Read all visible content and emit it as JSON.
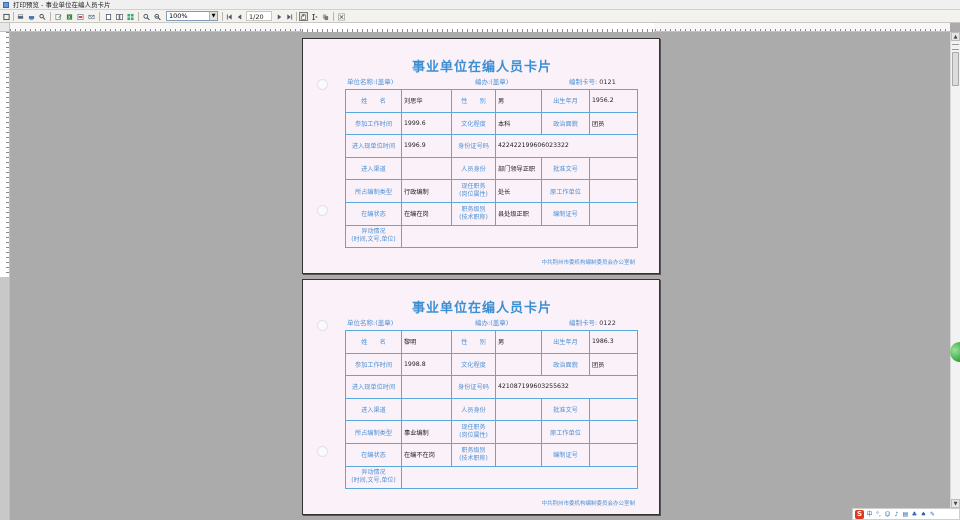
{
  "window": {
    "title": "打印预览 - 事业单位在编人员卡片"
  },
  "toolbar": {
    "zoom": "100%",
    "page": "1/20"
  },
  "labels": {
    "card_title": "事业单位在编人员卡片",
    "unit_name": "单位名称:(盖章)",
    "org_name": "编办:(盖章)",
    "card_no": "编制卡号:",
    "name": "姓　　名",
    "gender": "性　　别",
    "birth": "出生年月",
    "work_start": "参加工作时间",
    "education": "文化程度",
    "politics": "政治面貌",
    "join_unit": "进入现单位时间",
    "id_no": "身份证号码",
    "channel": "进入渠道",
    "identity": "人员身份",
    "approval_no": "批准文号",
    "staff_type": "所占编制类型",
    "position_l1": "现任职务",
    "position_l2": "(岗位属性)",
    "former_unit": "原工作单位",
    "status": "在编状态",
    "grade_l1": "职务级别",
    "grade_l2": "(技术职称)",
    "cert_no": "编制证号",
    "change_l1": "异动情况",
    "change_l2": "(时间,文号,单位)",
    "footer": "中共荆州市委机构编制委员会办公室制"
  },
  "cards": [
    {
      "card_no": "0121",
      "name": "刘思华",
      "gender": "男",
      "birth": "1956.2",
      "work_start": "1999.6",
      "education": "本科",
      "politics": "团员",
      "join_unit": "1996.9",
      "id_no": "422422199606023322",
      "channel": "",
      "identity": "部门领导正职",
      "approval_no": "",
      "staff_type": "行政编制",
      "position": "处长",
      "former_unit": "",
      "status": "在编在岗",
      "grade": "县处级正职",
      "cert_no": "",
      "change": ""
    },
    {
      "card_no": "0122",
      "name": "黎明",
      "gender": "男",
      "birth": "1986.3",
      "work_start": "1998.8",
      "education": "",
      "politics": "团员",
      "join_unit": "",
      "id_no": "421087199603255632",
      "channel": "",
      "identity": "",
      "approval_no": "",
      "staff_type": "事业编制",
      "position": "",
      "former_unit": "",
      "status": "在编不在岗",
      "grade": "",
      "cert_no": "",
      "change": ""
    }
  ],
  "tray": {
    "ime": "中"
  },
  "colors": {
    "accent": "#3a8fd3",
    "border": "#59a9dd",
    "paper": "#fbf1f8"
  }
}
